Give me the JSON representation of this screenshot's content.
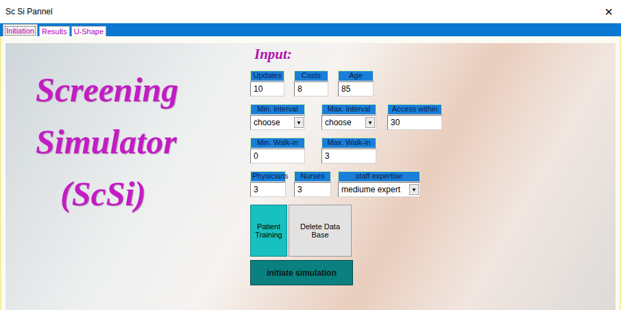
{
  "window": {
    "title": "Sc Si Pannel",
    "close": "×"
  },
  "tabs": [
    {
      "label": "Initiation",
      "selected": true
    },
    {
      "label": "Results",
      "selected": false
    },
    {
      "label": "U-Shape",
      "selected": false
    }
  ],
  "app_title": {
    "lines": [
      "Screening",
      "Simulator",
      "(ScSi)"
    ]
  },
  "input_heading": "Input:",
  "field_rows": [
    [
      {
        "label": "Updates",
        "value": "10",
        "kind": "text"
      },
      {
        "label": "Costs",
        "value": "8",
        "kind": "text"
      },
      {
        "label": "Age",
        "value": "85",
        "kind": "text"
      }
    ],
    [
      {
        "label": "Min. interval",
        "value": "choose",
        "kind": "dropdown",
        "arrow": "▼"
      },
      {
        "label": "Max. interval",
        "value": "choose",
        "kind": "dropdown",
        "arrow": "▼"
      },
      {
        "label": "Access within",
        "value": "30",
        "kind": "text"
      }
    ],
    [
      {
        "label": "Min. Walk-in",
        "value": "0",
        "kind": "text"
      },
      {
        "label": "Max. Walk-in",
        "value": "3",
        "kind": "text"
      }
    ],
    [
      {
        "label": "Physicians",
        "value": "3",
        "kind": "text"
      },
      {
        "label": "Nurses",
        "value": "3",
        "kind": "text"
      },
      {
        "label": "staff expertise",
        "value": "mediume expert",
        "kind": "dropdown",
        "arrow": "▼"
      }
    ]
  ],
  "buttons": {
    "training": "Patient Training",
    "delete": "Delete Data Base",
    "initiate": "initiate simulation"
  }
}
